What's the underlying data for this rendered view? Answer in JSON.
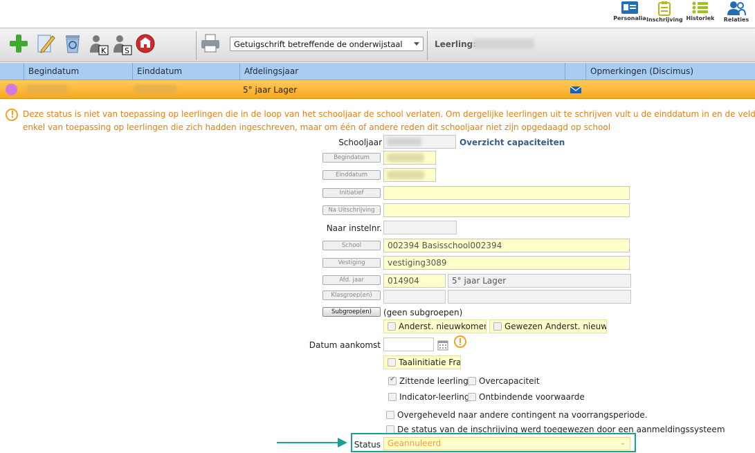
{
  "topnav": {
    "items": [
      {
        "label": "Personalia",
        "icon": "id-card-icon",
        "active": true
      },
      {
        "label": "Inschrijving",
        "icon": "clipboard-icon"
      },
      {
        "label": "Historiek",
        "icon": "list-icon"
      },
      {
        "label": "Relaties",
        "icon": "people-icon"
      }
    ]
  },
  "toolbar": {
    "document_select": "Getuigschrift betreffende de onderwijstaal",
    "leerling_label": "Leerling:",
    "k_badge": "K",
    "s_badge": "S"
  },
  "grid": {
    "columns": [
      "Begindatum",
      "Einddatum",
      "Afdelingsjaar",
      "Opmerkingen (Discimus)"
    ],
    "row": {
      "afdelingsjaar": "5° jaar Lager"
    }
  },
  "warning": {
    "line1": "Deze status is niet van toepassing op leerlingen die in de loop van het schooljaar de school verlaten. Om dergelijke leerlingen uit te schrijven vult u de einddatum in en de velden In",
    "line2": "enkel van toepassing op leerlingen die zich hadden ingeschreven, maar om één of andere reden dit schooljaar niet zijn opgedaagd op school"
  },
  "form": {
    "schooljaar_label": "Schooljaar",
    "overzicht_link": "Overzicht capaciteiten",
    "begindatum_btn": "Begindatum",
    "einddatum_btn": "Einddatum",
    "initiatief_btn": "Initiatief",
    "na_uitschrijving_btn": "Na Uitschrijving",
    "naar_instelnr_label": "Naar instelnr.",
    "school_btn": "School",
    "school_value": "002394 Basisschool002394",
    "vestiging_btn": "Vestiging",
    "vestiging_value": "vestiging3089",
    "afd_jaar_btn": "Afd. jaar",
    "afd_jaar_code": "014904",
    "afd_jaar_name": "5° jaar Lager",
    "klasgroep_btn": "Klasgroep(en)",
    "subgroep_btn": "Subgroep(en)",
    "subgroep_value": "(geen subgroepen)",
    "anderst_nieuwkomer": "Anderst. nieuwkomer",
    "gewezen_anderst": "Gewezen Anderst. nieuwk.",
    "datum_aankomst_label": "Datum aankomst",
    "taalinitiatie": "Taalinitiatie Frans",
    "zittende_leerling": "Zittende leerling",
    "overcapaciteit": "Overcapaciteit",
    "indicator_leerling": "Indicator-leerling",
    "ontbindende_voorwaarde": "Ontbindende voorwaarde",
    "overgeheveld": "Overgeheveld naar andere contingent na voorrangsperiode.",
    "status_toegewezen": "De status van de inschrijving werd toegewezen door een aanmeldingssysteem",
    "status_label": "Status",
    "status_value": "Geannuleerd"
  },
  "colors": {
    "accent": "#1aa193",
    "grid_header": "#a9cdf0",
    "selected_row": "#f7a91f",
    "warning_text": "#e67e0e"
  }
}
